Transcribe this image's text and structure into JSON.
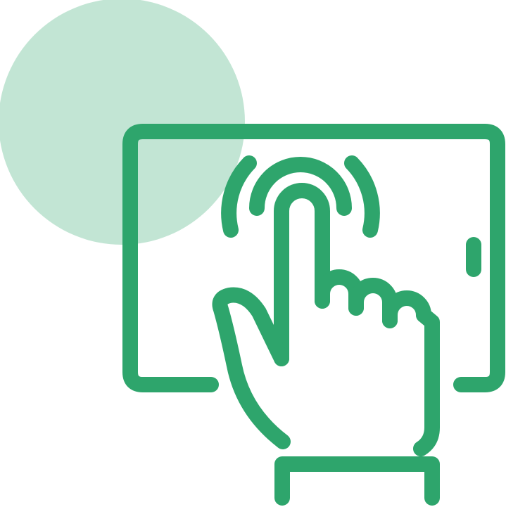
{
  "illustration": {
    "icon": "tap-touchscreen-icon",
    "colors": {
      "primary": "#2EA56C",
      "accent_circle": "#C2E5D4",
      "background": "#FFFFFF"
    }
  }
}
